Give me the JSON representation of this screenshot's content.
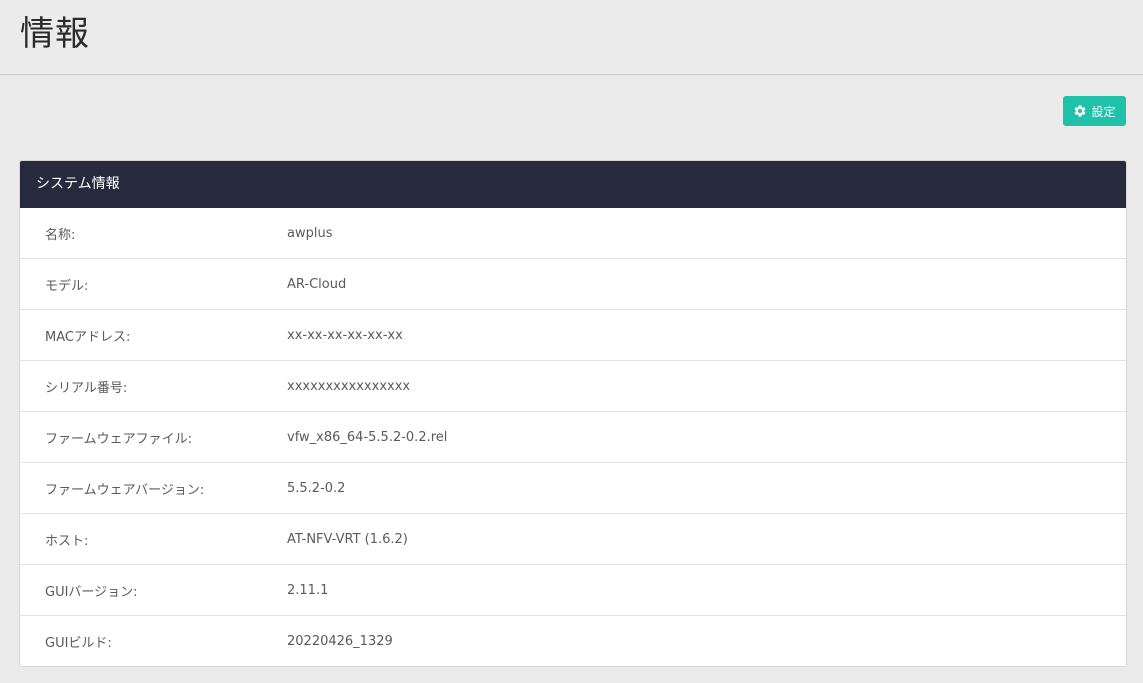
{
  "page": {
    "title": "情報"
  },
  "toolbar": {
    "settings_label": "設定",
    "settings_icon": "gear-icon"
  },
  "panel": {
    "title": "システム情報",
    "rows": [
      {
        "label": "名称:",
        "value": "awplus"
      },
      {
        "label": "モデル:",
        "value": "AR-Cloud"
      },
      {
        "label": "MACアドレス:",
        "value": "xx-xx-xx-xx-xx-xx"
      },
      {
        "label": "シリアル番号:",
        "value": "xxxxxxxxxxxxxxxx"
      },
      {
        "label": "ファームウェアファイル:",
        "value": "vfw_x86_64-5.5.2-0.2.rel"
      },
      {
        "label": "ファームウェアバージョン:",
        "value": "5.5.2-0.2"
      },
      {
        "label": "ホスト:",
        "value": "AT-NFV-VRT (1.6.2)"
      },
      {
        "label": "GUIバージョン:",
        "value": "2.11.1"
      },
      {
        "label": "GUIビルド:",
        "value": "20220426_1329"
      }
    ]
  },
  "colors": {
    "background": "#ebebeb",
    "panel_header": "#272a3c",
    "accent": "#1fc1a8"
  }
}
